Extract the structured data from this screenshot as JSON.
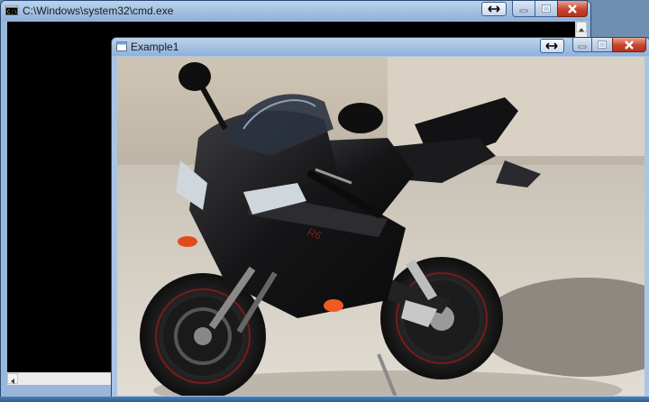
{
  "cmd_window": {
    "title": "C:\\Windows\\system32\\cmd.exe",
    "icon": "console-icon",
    "snap_icon": "resize-arrows-icon",
    "minimize_icon": "minimize-icon",
    "maximize_icon": "maximize-icon",
    "close_icon": "close-icon"
  },
  "image_window": {
    "title": "Example1",
    "icon": "window-icon",
    "snap_icon": "resize-arrows-icon",
    "minimize_icon": "minimize-icon",
    "maximize_icon": "maximize-icon",
    "close_icon": "close-icon",
    "content": "photo of a black sport motorcycle"
  },
  "colors": {
    "console_bg": "#000000",
    "titlebar": "#a7c3e4",
    "close_button": "#c7452b"
  }
}
